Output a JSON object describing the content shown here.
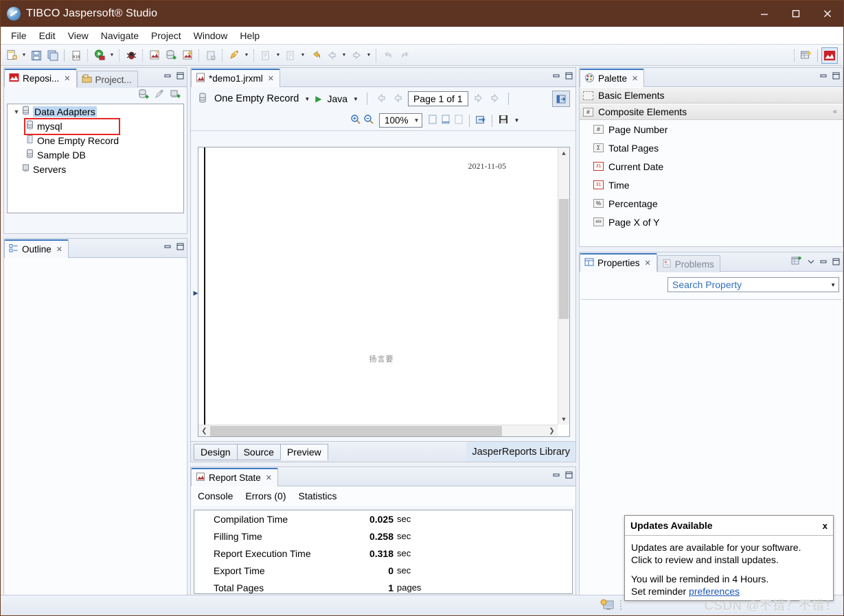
{
  "window": {
    "title": "TIBCO Jaspersoft® Studio",
    "icon": "jaspersoft-logo-icon",
    "controls": {
      "minimize": "–",
      "maximize": "□",
      "close": "✕"
    },
    "titlebar_color": "#5d3322"
  },
  "menubar": {
    "items": [
      "File",
      "Edit",
      "View",
      "Navigate",
      "Project",
      "Window",
      "Help"
    ]
  },
  "toolbar": {
    "icons": [
      "new-report-icon",
      "save-icon",
      "save-all-icon",
      "binary-icon",
      "run-icon",
      "debug-icon",
      "compile-report-icon",
      "new-datasource-icon",
      "new-jrxml-icon",
      "blank-doc-icon",
      "quick-access-icon",
      "external-tools-icon",
      "next-annotation-icon",
      "previous-edit-icon",
      "back-icon",
      "forward-icon",
      "undo-icon",
      "redo-icon"
    ],
    "perspective_icon": "jasperreports-perspective-icon",
    "open-perspective-icon": "open-perspective-icon"
  },
  "repository": {
    "tabs": [
      {
        "label": "Reposi...",
        "icon": "repository-icon",
        "active": true
      },
      {
        "label": "Project...",
        "icon": "project-explorer-icon",
        "active": false
      }
    ],
    "tools": [
      "new-data-adapter-icon",
      "connect-icon",
      "new-server-icon"
    ],
    "tree": [
      {
        "label": "Data Adapters",
        "icon": "database-icon",
        "indent": 0,
        "expanded": true,
        "selected": true,
        "boxed": false
      },
      {
        "label": "mysql",
        "icon": "database-icon",
        "indent": 1,
        "selected": false,
        "boxed": true
      },
      {
        "label": "One Empty Record",
        "icon": "empty-record-icon",
        "indent": 1,
        "selected": false,
        "boxed": false
      },
      {
        "label": "Sample DB",
        "icon": "database-icon",
        "indent": 1,
        "selected": false,
        "boxed": false
      },
      {
        "label": "Servers",
        "icon": "server-icon",
        "indent": 0,
        "selected": false,
        "boxed": false
      }
    ],
    "highlight_color": "#e8251f"
  },
  "outline": {
    "tab": {
      "label": "Outline",
      "icon": "outline-icon"
    },
    "content": ""
  },
  "editor": {
    "tab": {
      "label": "*demo1.jrxml",
      "icon": "jrxml-file-icon"
    },
    "datasource": "One Empty Record",
    "datasource_icon": "database-icon",
    "run_icon": "run-report-icon",
    "language": "Java",
    "page_indicator": "Page 1 of 1",
    "zoom": "100%",
    "nav_icons": [
      "first-page-icon",
      "previous-page-icon",
      "next-page-icon",
      "last-page-icon"
    ],
    "zoom_icons": [
      "zoom-in-icon",
      "zoom-out-icon"
    ],
    "page_fit_icons": [
      "actual-size-icon",
      "fit-page-icon",
      "fit-width-icon"
    ],
    "export_icon": "export-report-icon",
    "save_icon": "save-report-icon",
    "open-external-icon": "open-external-viewer-icon",
    "preview": {
      "date": "2021-11-05",
      "body_text": "扬言要"
    },
    "bottom_tabs": [
      {
        "label": "Design",
        "active": false
      },
      {
        "label": "Source",
        "active": false
      },
      {
        "label": "Preview",
        "active": true
      }
    ],
    "library_label": "JasperReports Library"
  },
  "report_state": {
    "tab": {
      "label": "Report State",
      "icon": "report-state-icon"
    },
    "subtabs": [
      "Console",
      "Errors (0)",
      "Statistics"
    ],
    "statistics": [
      {
        "name": "Compilation Time",
        "value": "0.025",
        "unit": "sec"
      },
      {
        "name": "Filling Time",
        "value": "0.258",
        "unit": "sec"
      },
      {
        "name": "Report Execution Time",
        "value": "0.318",
        "unit": "sec"
      },
      {
        "name": "Export Time",
        "value": "0",
        "unit": "sec"
      },
      {
        "name": "Total Pages",
        "value": "1",
        "unit": "pages"
      }
    ]
  },
  "palette": {
    "tab": {
      "label": "Palette",
      "icon": "palette-icon"
    },
    "groups": [
      {
        "label": "Basic Elements",
        "glyph": "▫",
        "icon": "basic-elements-icon",
        "collapsed": true
      },
      {
        "label": "Composite Elements",
        "glyph": "#",
        "icon": "composite-elements-icon",
        "collapsed": false
      }
    ],
    "items": [
      {
        "label": "Page Number",
        "glyph": "#",
        "icon": "page-number-icon"
      },
      {
        "label": "Total Pages",
        "glyph": "Σ",
        "icon": "total-pages-icon"
      },
      {
        "label": "Current Date",
        "glyph": "31",
        "icon": "current-date-icon"
      },
      {
        "label": "Time",
        "glyph": "31",
        "icon": "time-icon"
      },
      {
        "label": "Percentage",
        "glyph": "%",
        "icon": "percentage-icon"
      },
      {
        "label": "Page X of Y",
        "glyph": "#/#",
        "icon": "page-x-of-y-icon"
      }
    ]
  },
  "properties": {
    "tabs": [
      {
        "label": "Properties",
        "icon": "properties-icon",
        "active": true
      },
      {
        "label": "Problems",
        "icon": "problems-icon",
        "active": false
      }
    ],
    "search_placeholder": "Search Property",
    "search_value": "Search Property",
    "toolbar_icons": [
      "new-property-icon",
      "view-menu-icon"
    ]
  },
  "updates_popup": {
    "title": "Updates Available",
    "close": "x",
    "line1": "Updates are available for your software.",
    "line2": "Click to review and install updates.",
    "line3": "You will be reminded in 4 Hours.",
    "line4_prefix": "Set reminder ",
    "link": "preferences"
  },
  "statusbar": {
    "icon": "workspace-icon"
  },
  "watermark": "CSDN @不错？不错！"
}
